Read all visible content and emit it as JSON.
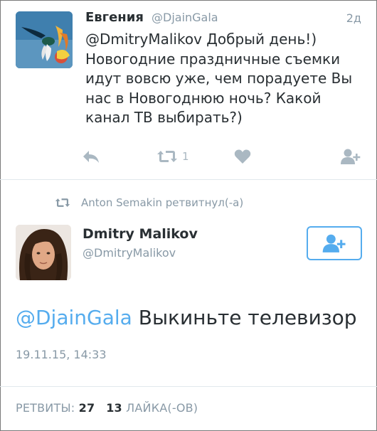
{
  "reply_tweet": {
    "author_name": "Евгения",
    "author_handle": "@DjainGala",
    "time": "2д",
    "text": "@DmitryMalikov Добрый день!) Новогодние праздничные съемки идут вовсю уже, чем порадуете Вы нас в Новогоднюю ночь? Какой канал ТВ выбирать?)",
    "actions": {
      "reply_icon": "reply-icon",
      "retweet_icon": "retweet-icon",
      "retweet_count": "1",
      "like_icon": "heart-icon",
      "follow_icon": "add-user-icon"
    }
  },
  "retweet_label": {
    "icon": "retweet-icon",
    "text": "Anton Semakin ретвитнул(-а)"
  },
  "main_tweet": {
    "author_name": "Dmitry Malikov",
    "author_handle": "@DmitryMalikov",
    "follow_icon": "add-user-icon",
    "mention": "@DjainGala",
    "body": " Выкиньте телевизор",
    "date": "19.11.15, 14:33"
  },
  "stats": {
    "retweets_label": "РЕТВИТЫ:",
    "retweets_count": "27",
    "likes_count": "13",
    "likes_label": "ЛАЙКА(-ОВ)"
  },
  "colors": {
    "text": "#292f33",
    "muted": "#8899a6",
    "icon": "#aab8c2",
    "accent": "#55acee",
    "divider": "#e1e8ed"
  }
}
